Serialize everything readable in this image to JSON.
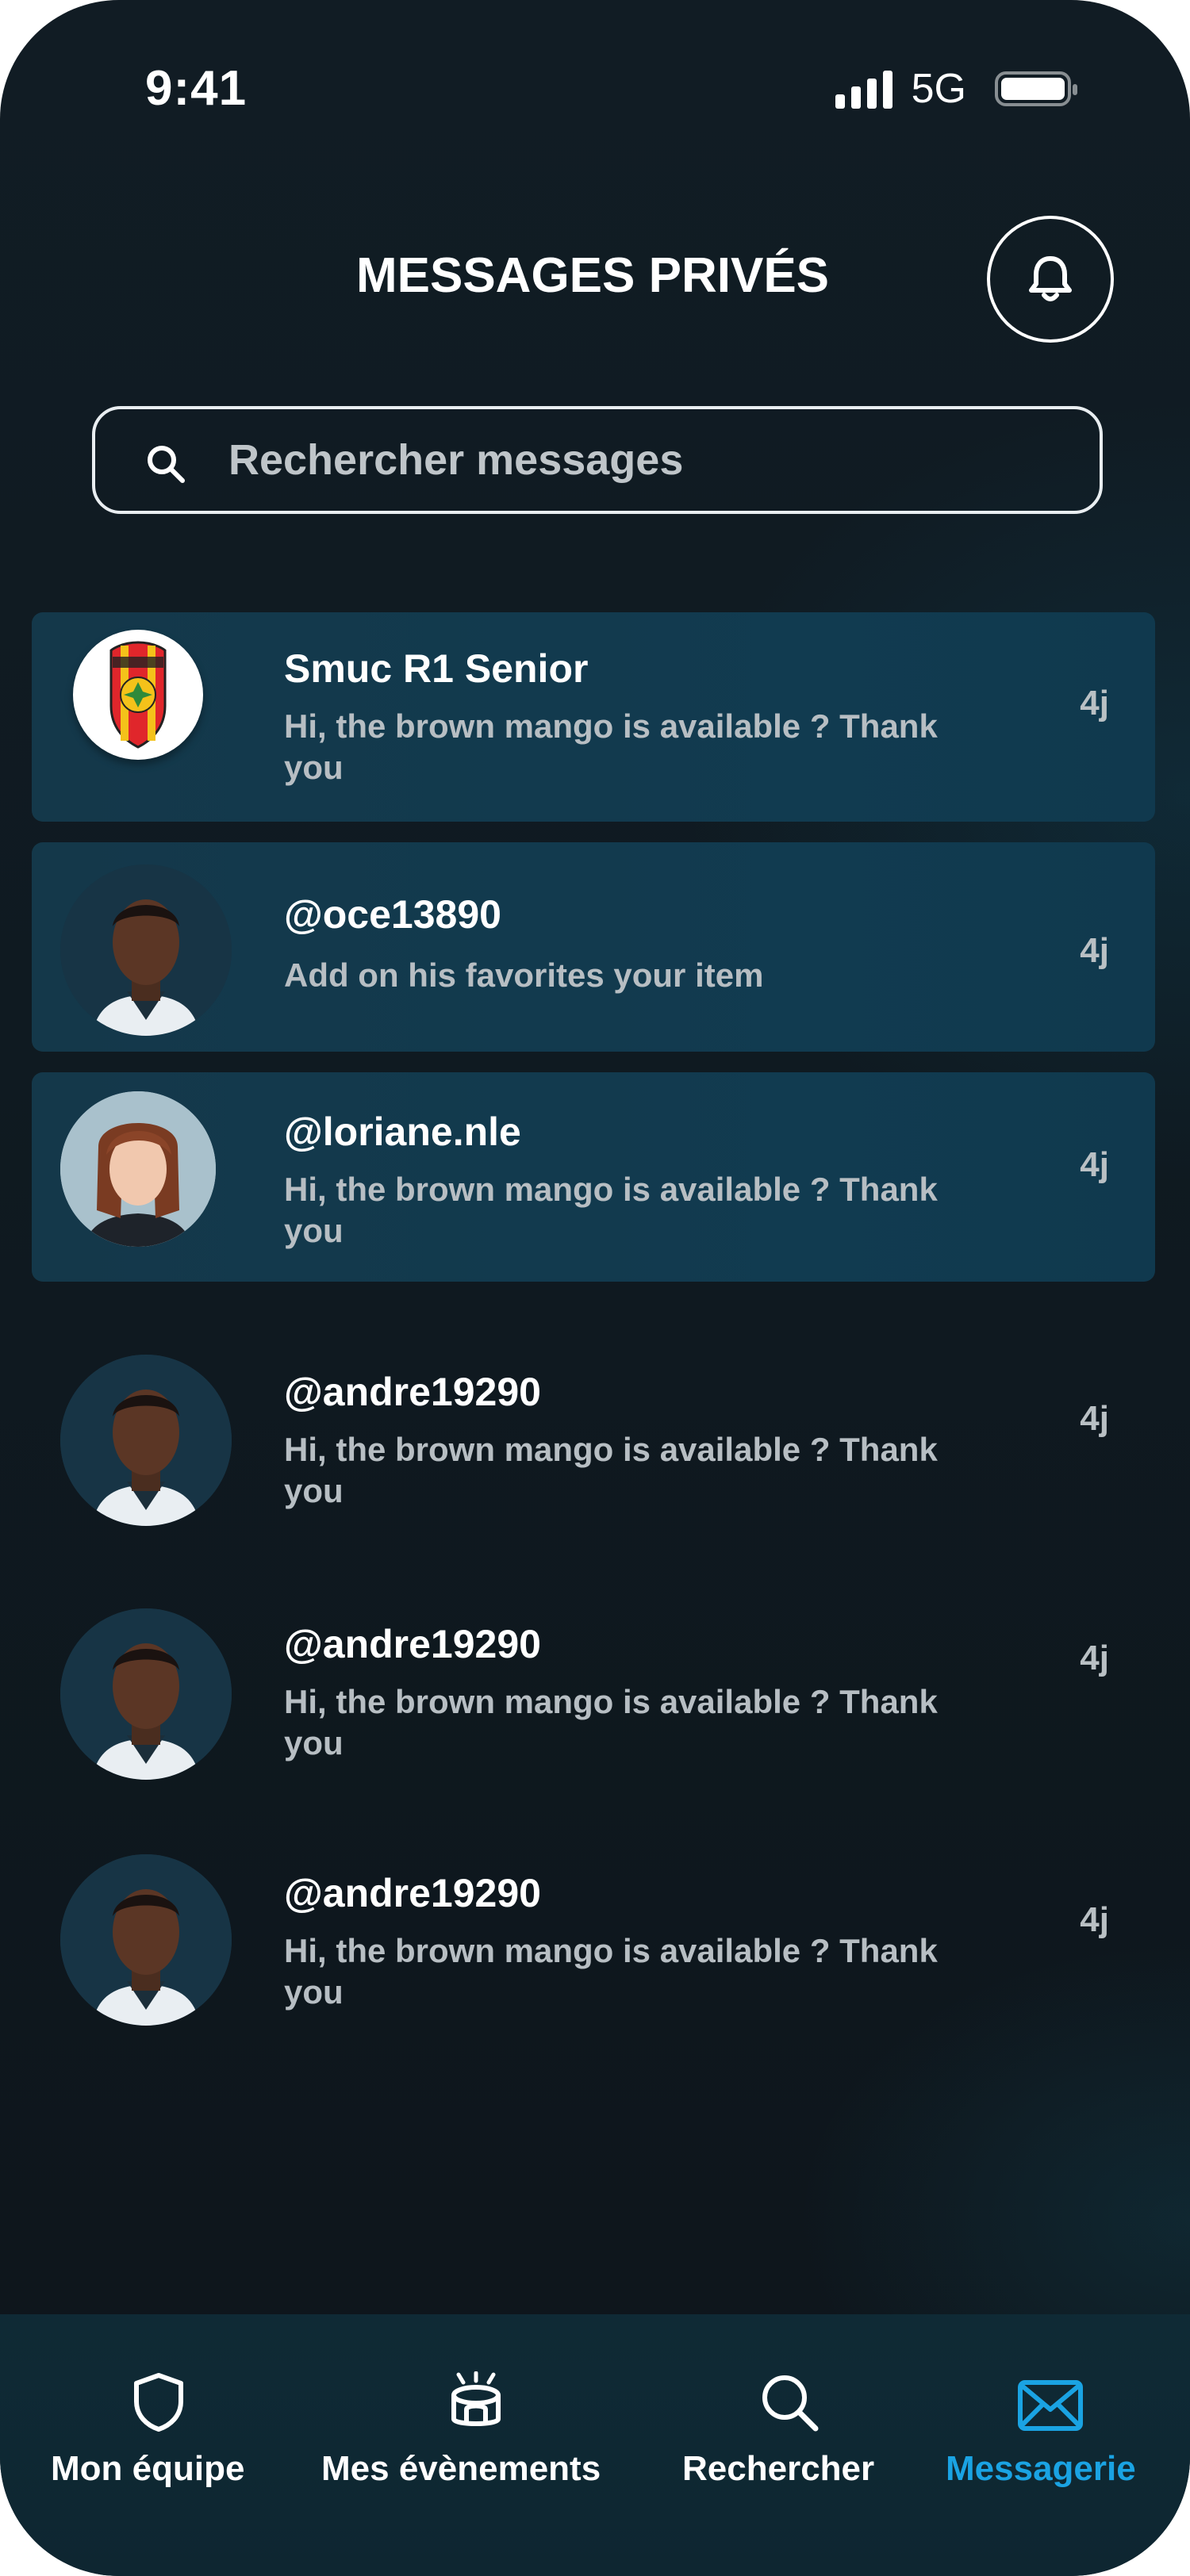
{
  "status_bar": {
    "time": "9:41",
    "network": "5G"
  },
  "header": {
    "title": "MESSAGES PRIVÉS",
    "notification_icon": "bell-icon"
  },
  "search": {
    "placeholder": "Rechercher messages",
    "value": ""
  },
  "conversations": [
    {
      "name": "Smuc R1 Senior",
      "message": "Hi, the brown mango is available ? Thank you",
      "time": "4j",
      "highlighted": true,
      "avatar": "club-logo"
    },
    {
      "name": "@oce13890",
      "message": "Add on his favorites your item",
      "time": "4j",
      "highlighted": true,
      "avatar": "user-photo"
    },
    {
      "name": "@loriane.nle",
      "message": "Hi, the brown mango is available ? Thank you",
      "time": "4j",
      "highlighted": true,
      "avatar": "user-photo"
    },
    {
      "name": "@andre19290",
      "message": "Hi, the brown mango is available ? Thank you",
      "time": "4j",
      "highlighted": false,
      "avatar": "user-photo"
    },
    {
      "name": "@andre19290",
      "message": "Hi, the brown mango is available ? Thank you",
      "time": "4j",
      "highlighted": false,
      "avatar": "user-photo"
    },
    {
      "name": "@andre19290",
      "message": "Hi, the brown mango is available ? Thank you",
      "time": "4j",
      "highlighted": false,
      "avatar": "user-photo"
    }
  ],
  "tabs": [
    {
      "label": "Mon équipe",
      "icon": "shield-icon",
      "active": false
    },
    {
      "label": "Mes évènements",
      "icon": "stadium-icon",
      "active": false
    },
    {
      "label": "Rechercher",
      "icon": "search-icon",
      "active": false
    },
    {
      "label": "Messagerie",
      "icon": "mail-icon",
      "active": true
    }
  ],
  "colors": {
    "accent": "#1aa3e3",
    "background": "#111c24",
    "highlight_row": "#113b50"
  }
}
